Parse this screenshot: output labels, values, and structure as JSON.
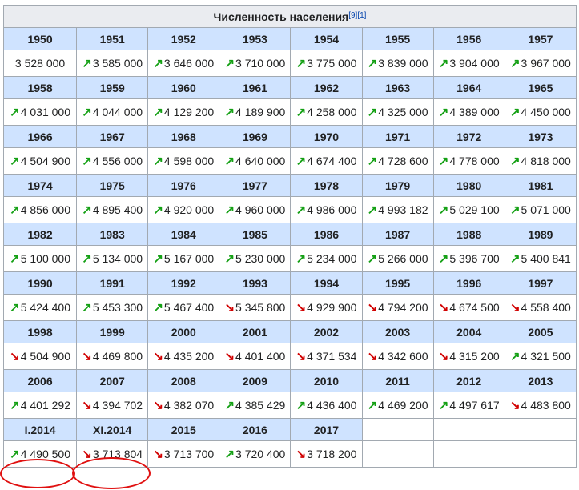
{
  "title": "Численность населения",
  "refs": [
    "[9]",
    "[1]"
  ],
  "colors": {
    "up": "#14a014",
    "down": "#d10000",
    "header_bg": "#cfe3ff",
    "circle": "#e01010"
  },
  "rows": [
    {
      "years": [
        "1950",
        "1951",
        "1952",
        "1953",
        "1954",
        "1955",
        "1956",
        "1957"
      ],
      "values": [
        {
          "v": "3 528 000",
          "t": "none"
        },
        {
          "v": "3 585 000",
          "t": "up"
        },
        {
          "v": "3 646 000",
          "t": "up"
        },
        {
          "v": "3 710 000",
          "t": "up"
        },
        {
          "v": "3 775 000",
          "t": "up"
        },
        {
          "v": "3 839 000",
          "t": "up"
        },
        {
          "v": "3 904 000",
          "t": "up"
        },
        {
          "v": "3 967 000",
          "t": "up"
        }
      ]
    },
    {
      "years": [
        "1958",
        "1959",
        "1960",
        "1961",
        "1962",
        "1963",
        "1964",
        "1965"
      ],
      "values": [
        {
          "v": "4 031 000",
          "t": "up"
        },
        {
          "v": "4 044 000",
          "t": "up"
        },
        {
          "v": "4 129 200",
          "t": "up"
        },
        {
          "v": "4 189 900",
          "t": "up"
        },
        {
          "v": "4 258 000",
          "t": "up"
        },
        {
          "v": "4 325 000",
          "t": "up"
        },
        {
          "v": "4 389 000",
          "t": "up"
        },
        {
          "v": "4 450 000",
          "t": "up"
        }
      ]
    },
    {
      "years": [
        "1966",
        "1967",
        "1968",
        "1969",
        "1970",
        "1971",
        "1972",
        "1973"
      ],
      "values": [
        {
          "v": "4 504 900",
          "t": "up"
        },
        {
          "v": "4 556 000",
          "t": "up"
        },
        {
          "v": "4 598 000",
          "t": "up"
        },
        {
          "v": "4 640 000",
          "t": "up"
        },
        {
          "v": "4 674 400",
          "t": "up"
        },
        {
          "v": "4 728 600",
          "t": "up"
        },
        {
          "v": "4 778 000",
          "t": "up"
        },
        {
          "v": "4 818 000",
          "t": "up"
        }
      ]
    },
    {
      "years": [
        "1974",
        "1975",
        "1976",
        "1977",
        "1978",
        "1979",
        "1980",
        "1981"
      ],
      "values": [
        {
          "v": "4 856 000",
          "t": "up"
        },
        {
          "v": "4 895 400",
          "t": "up"
        },
        {
          "v": "4 920 000",
          "t": "up"
        },
        {
          "v": "4 960 000",
          "t": "up"
        },
        {
          "v": "4 986 000",
          "t": "up"
        },
        {
          "v": "4 993 182",
          "t": "up"
        },
        {
          "v": "5 029 100",
          "t": "up"
        },
        {
          "v": "5 071 000",
          "t": "up"
        }
      ]
    },
    {
      "years": [
        "1982",
        "1983",
        "1984",
        "1985",
        "1986",
        "1987",
        "1988",
        "1989"
      ],
      "values": [
        {
          "v": "5 100 000",
          "t": "up"
        },
        {
          "v": "5 134 000",
          "t": "up"
        },
        {
          "v": "5 167 000",
          "t": "up"
        },
        {
          "v": "5 230 000",
          "t": "up"
        },
        {
          "v": "5 234 000",
          "t": "up"
        },
        {
          "v": "5 266 000",
          "t": "up"
        },
        {
          "v": "5 396 700",
          "t": "up"
        },
        {
          "v": "5 400 841",
          "t": "up"
        }
      ]
    },
    {
      "years": [
        "1990",
        "1991",
        "1992",
        "1993",
        "1994",
        "1995",
        "1996",
        "1997"
      ],
      "values": [
        {
          "v": "5 424 400",
          "t": "up"
        },
        {
          "v": "5 453 300",
          "t": "up"
        },
        {
          "v": "5 467 400",
          "t": "up"
        },
        {
          "v": "5 345 800",
          "t": "down"
        },
        {
          "v": "4 929 900",
          "t": "down"
        },
        {
          "v": "4 794 200",
          "t": "down"
        },
        {
          "v": "4 674 500",
          "t": "down"
        },
        {
          "v": "4 558 400",
          "t": "down"
        }
      ]
    },
    {
      "years": [
        "1998",
        "1999",
        "2000",
        "2001",
        "2002",
        "2003",
        "2004",
        "2005"
      ],
      "values": [
        {
          "v": "4 504 900",
          "t": "down"
        },
        {
          "v": "4 469 800",
          "t": "down"
        },
        {
          "v": "4 435 200",
          "t": "down"
        },
        {
          "v": "4 401 400",
          "t": "down"
        },
        {
          "v": "4 371 534",
          "t": "down"
        },
        {
          "v": "4 342 600",
          "t": "down"
        },
        {
          "v": "4 315 200",
          "t": "down"
        },
        {
          "v": "4 321 500",
          "t": "up"
        }
      ]
    },
    {
      "years": [
        "2006",
        "2007",
        "2008",
        "2009",
        "2010",
        "2011",
        "2012",
        "2013"
      ],
      "values": [
        {
          "v": "4 401 292",
          "t": "up"
        },
        {
          "v": "4 394 702",
          "t": "down"
        },
        {
          "v": "4 382 070",
          "t": "down"
        },
        {
          "v": "4 385 429",
          "t": "up"
        },
        {
          "v": "4 436 400",
          "t": "up"
        },
        {
          "v": "4 469 200",
          "t": "up"
        },
        {
          "v": "4 497 617",
          "t": "up"
        },
        {
          "v": "4 483 800",
          "t": "down"
        }
      ]
    },
    {
      "years": [
        "I.2014",
        "XI.2014",
        "2015",
        "2016",
        "2017",
        "",
        "",
        ""
      ],
      "values": [
        {
          "v": "4 490 500",
          "t": "up"
        },
        {
          "v": "3 713 804",
          "t": "down"
        },
        {
          "v": "3 713 700",
          "t": "down"
        },
        {
          "v": "3 720 400",
          "t": "up"
        },
        {
          "v": "3 718 200",
          "t": "down"
        },
        {
          "v": "",
          "t": "blank"
        },
        {
          "v": "",
          "t": "blank"
        },
        {
          "v": "",
          "t": "blank"
        }
      ]
    }
  ],
  "highlighted": [
    "I.2014",
    "XI.2014"
  ]
}
